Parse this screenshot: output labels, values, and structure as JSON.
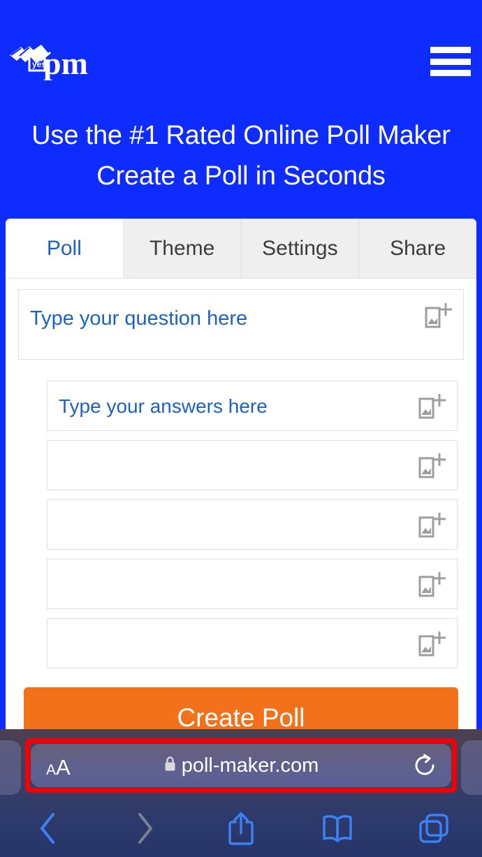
{
  "site": {
    "logo_text": "pm",
    "logo_badge_text": "yes",
    "logo_name": "poll-maker-logo",
    "menu_icon": "hamburger-menu-icon",
    "headline_line1": "Use the #1 Rated Online Poll Maker",
    "headline_line2": "Create a Poll in Seconds",
    "header_bg": "#0d2cfd"
  },
  "tabs": [
    {
      "label": "Poll",
      "active": true
    },
    {
      "label": "Theme",
      "active": false
    },
    {
      "label": "Settings",
      "active": false
    },
    {
      "label": "Share",
      "active": false
    }
  ],
  "poll_form": {
    "question_placeholder": "Type your question here",
    "question_image_icon": "add-image-icon",
    "answers": [
      {
        "placeholder": "Type your answers here"
      },
      {
        "placeholder": ""
      },
      {
        "placeholder": ""
      },
      {
        "placeholder": ""
      },
      {
        "placeholder": ""
      }
    ],
    "submit_label": "Create Poll",
    "submit_color": "#f4711b"
  },
  "browser": {
    "text_size_label_small": "A",
    "text_size_label_large": "A",
    "text_size_name": "text-size-button",
    "lock_icon": "lock-icon",
    "url": "poll-maker.com",
    "reload_icon": "reload-icon",
    "annotation_color": "#f40000",
    "toolbar": [
      {
        "name": "back-button",
        "icon": "chevron-left-icon",
        "enabled": true
      },
      {
        "name": "forward-button",
        "icon": "chevron-right-icon",
        "enabled": false
      },
      {
        "name": "share-button",
        "icon": "share-icon",
        "enabled": true
      },
      {
        "name": "bookmarks-button",
        "icon": "book-icon",
        "enabled": true
      },
      {
        "name": "tabs-button",
        "icon": "tabs-icon",
        "enabled": true
      }
    ]
  }
}
